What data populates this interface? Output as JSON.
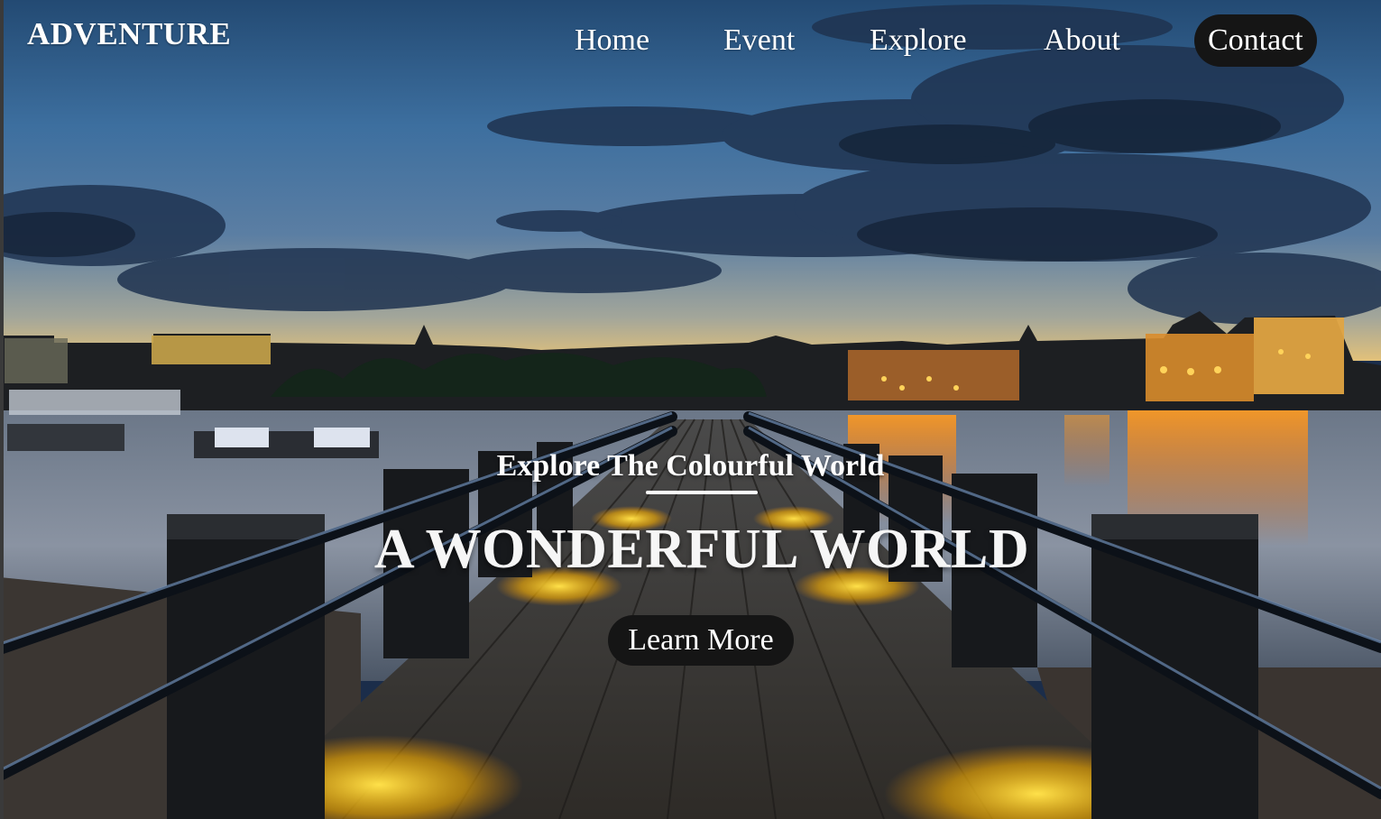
{
  "brand": {
    "name": "ADVENTURE"
  },
  "nav": {
    "items": [
      {
        "label": "Home"
      },
      {
        "label": "Event"
      },
      {
        "label": "Explore"
      },
      {
        "label": "About"
      },
      {
        "label": "Contact"
      }
    ]
  },
  "hero": {
    "tagline": "Explore The Colourful World",
    "headline": "A WONDERFUL WORLD",
    "cta_label": "Learn More",
    "background_image": "river-pier-at-dusk-city-skyline"
  },
  "colors": {
    "text": "#ffffff",
    "button_bg": "#151515",
    "sky_top": "#2b5580",
    "water": "#5f6d80",
    "lights": "#ffb300"
  }
}
